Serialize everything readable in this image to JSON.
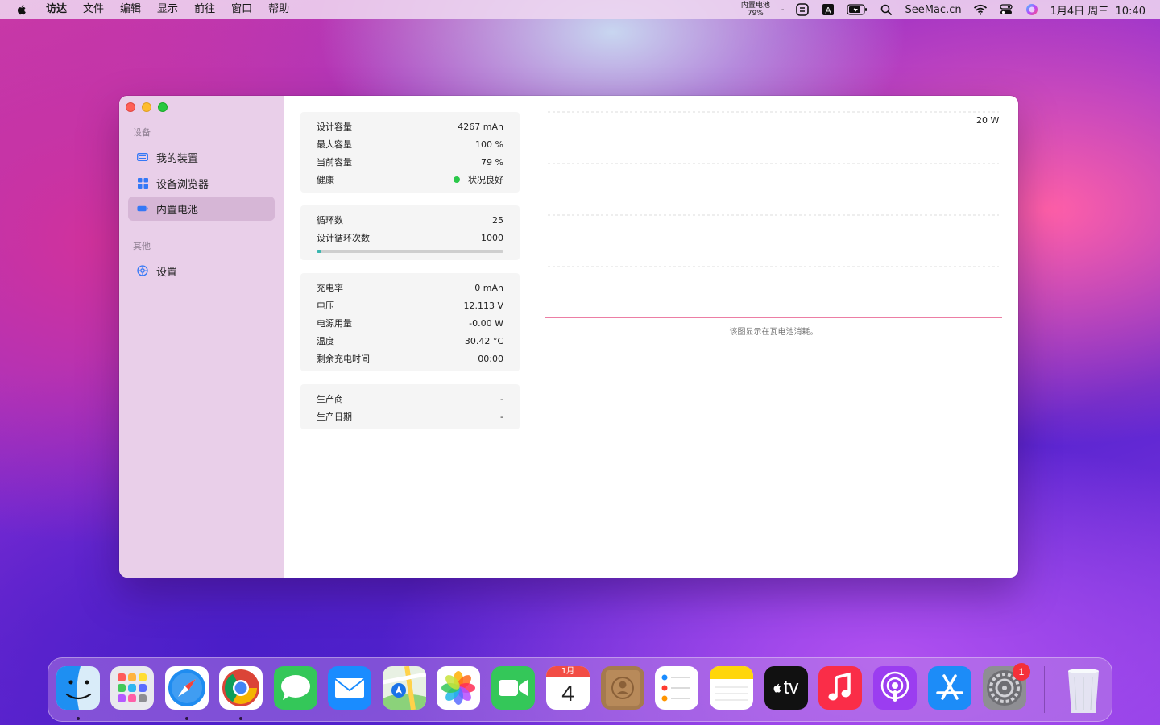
{
  "menubar": {
    "app_name": "访达",
    "items": [
      "文件",
      "编辑",
      "显示",
      "前往",
      "窗口",
      "帮助"
    ],
    "battery_mini_label": "内置电池",
    "battery_mini_value": "79%",
    "battery_mini_extra": "-",
    "site_text": "SeeMac.cn",
    "clock": "1月4日 周三  10:40"
  },
  "sidebar": {
    "section_devices": "设备",
    "items": [
      {
        "label": "我的装置",
        "icon": "keyboard-icon"
      },
      {
        "label": "设备浏览器",
        "icon": "grid-icon"
      },
      {
        "label": "内置电池",
        "icon": "battery-icon"
      }
    ],
    "section_other": "其他",
    "settings_label": "设置"
  },
  "cards": {
    "capacity": [
      {
        "label": "设计容量",
        "value": "4267 mAh"
      },
      {
        "label": "最大容量",
        "value": "100 %"
      },
      {
        "label": "当前容量",
        "value": "79 %"
      },
      {
        "label": "健康",
        "value": "状况良好"
      }
    ],
    "cycles": [
      {
        "label": "循环数",
        "value": "25"
      },
      {
        "label": "设计循环次数",
        "value": "1000"
      }
    ],
    "cycle_progress": 0.025,
    "power": [
      {
        "label": "充电率",
        "value": "0 mAh"
      },
      {
        "label": "电压",
        "value": "12.113 V"
      },
      {
        "label": "电源用量",
        "value": "-0.00 W"
      },
      {
        "label": "温度",
        "value": "30.42 °C"
      },
      {
        "label": "剩余充电时间",
        "value": "00:00"
      }
    ],
    "maker": [
      {
        "label": "生产商",
        "value": "-"
      },
      {
        "label": "生产日期",
        "value": "-"
      }
    ]
  },
  "chart": {
    "max_label": "20 W",
    "caption": "该图显示在瓦电池消耗。",
    "line_color": "#e0306e"
  },
  "dock": {
    "calendar_month": "1月",
    "calendar_day": "4",
    "tv_text": "tv",
    "settings_badge": "1"
  }
}
